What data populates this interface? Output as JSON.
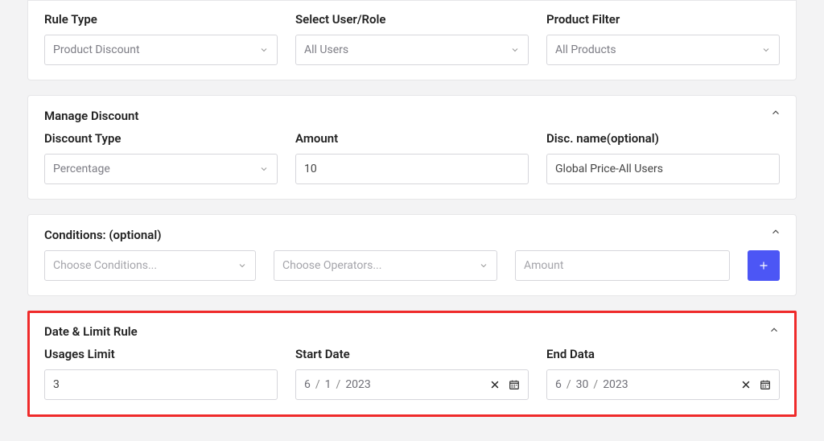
{
  "topRow": {
    "ruleType": {
      "label": "Rule Type",
      "value": "Product Discount"
    },
    "userRole": {
      "label": "Select User/Role",
      "value": "All Users"
    },
    "productFilter": {
      "label": "Product Filter",
      "value": "All Products"
    }
  },
  "manageDiscount": {
    "title": "Manage Discount",
    "discountType": {
      "label": "Discount Type",
      "value": "Percentage"
    },
    "amount": {
      "label": "Amount",
      "value": "10"
    },
    "discName": {
      "label": "Disc. name(optional)",
      "value": "Global Price-All Users"
    }
  },
  "conditions": {
    "title": "Conditions: (optional)",
    "conditionPlaceholder": "Choose Conditions...",
    "operatorPlaceholder": "Choose Operators...",
    "amountPlaceholder": "Amount"
  },
  "dateLimit": {
    "title": "Date & Limit Rule",
    "usagesLimit": {
      "label": "Usages Limit",
      "value": "3"
    },
    "startDate": {
      "label": "Start Date",
      "m": "6",
      "d": "1",
      "y": "2023"
    },
    "endDate": {
      "label": "End Data",
      "m": "6",
      "d": "30",
      "y": "2023"
    }
  }
}
